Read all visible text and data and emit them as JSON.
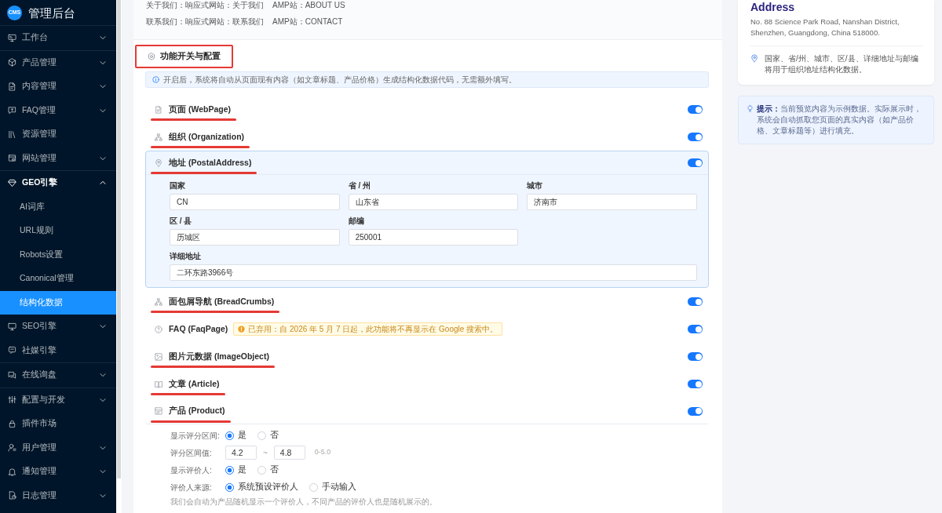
{
  "sidebar": {
    "logo_badge": "CMS",
    "title": "管理后台",
    "groups": [
      {
        "items": [
          {
            "label": "工作台",
            "kind": "menu",
            "expanded": false
          }
        ]
      },
      {
        "items": [
          {
            "label": "产品管理",
            "kind": "menu",
            "expanded": false
          },
          {
            "label": "内容管理",
            "kind": "menu",
            "expanded": false
          },
          {
            "label": "FAQ管理",
            "kind": "menu",
            "expanded": false
          },
          {
            "label": "资源管理",
            "kind": "link"
          },
          {
            "label": "网站管理",
            "kind": "menu",
            "expanded": false
          }
        ]
      },
      {
        "items": [
          {
            "label": "GEO引擎",
            "kind": "menu",
            "expanded": true,
            "children": [
              {
                "label": "AI词库",
                "selected": false
              },
              {
                "label": "URL规则",
                "selected": false
              },
              {
                "label": "Robots设置",
                "selected": false
              },
              {
                "label": "Canonical管理",
                "selected": false
              },
              {
                "label": "结构化数据",
                "selected": true
              }
            ]
          },
          {
            "label": "SEO引擎",
            "kind": "menu",
            "expanded": false
          },
          {
            "label": "社媒引擎",
            "kind": "link"
          }
        ]
      },
      {
        "items": [
          {
            "label": "在线询盘",
            "kind": "menu",
            "expanded": false
          }
        ]
      },
      {
        "items": [
          {
            "label": "配置与开发",
            "kind": "menu",
            "expanded": false
          },
          {
            "label": "插件市场",
            "kind": "link"
          },
          {
            "label": "用户管理",
            "kind": "menu",
            "expanded": false
          },
          {
            "label": "通知管理",
            "kind": "menu",
            "expanded": false
          },
          {
            "label": "日志管理",
            "kind": "menu",
            "expanded": false
          }
        ]
      }
    ]
  },
  "page_links": [
    {
      "site": "关于我们：响应式网站：关于我们",
      "amp": "AMP站：ABOUT US"
    },
    {
      "site": "联系我们：响应式网站：联系我们",
      "amp": "AMP站：CONTACT"
    }
  ],
  "features": {
    "title": "功能开关与配置",
    "outlined": true,
    "notice": "开启后，系统将自动从页面现有内容（如文章标题、产品价格）生成结构化数据代码，无需额外填写。",
    "types": [
      {
        "label": "页面 (WebPage)",
        "on": true,
        "underlined": true,
        "highlighted": false
      },
      {
        "label": "组织 (Organization)",
        "on": true,
        "underlined": true,
        "highlighted": false
      },
      {
        "label": "地址 (PostalAddress)",
        "on": true,
        "underlined": true,
        "highlighted": true,
        "fields": [
          {
            "label": "国家",
            "value": "CN",
            "kind": "short"
          },
          {
            "label": "省 / 州",
            "value": "山东省",
            "kind": "short"
          },
          {
            "label": "城市",
            "value": "济南市",
            "kind": "short"
          },
          {
            "label": "区 / 县",
            "value": "历城区",
            "kind": "short"
          },
          {
            "label": "邮编",
            "value": "250001",
            "kind": "short"
          },
          {
            "label": "详细地址",
            "value": "二环东路3966号",
            "kind": "long"
          }
        ]
      },
      {
        "label": "面包屑导航 (BreadCrumbs)",
        "on": true,
        "underlined": true,
        "highlighted": false
      },
      {
        "label": "FAQ (FaqPage)",
        "on": true,
        "underlined": false,
        "highlighted": false,
        "warning": "已弃用：自 2026 年 5 月 7 日起，此功能将不再显示在 Google 搜索中。"
      },
      {
        "label": "图片元数据 (ImageObject)",
        "on": true,
        "underlined": true,
        "highlighted": false
      },
      {
        "label": "文章 (Article)",
        "on": true,
        "underlined": true,
        "highlighted": false
      },
      {
        "label": "产品 (Product)",
        "on": true,
        "underlined": true,
        "highlighted": false,
        "options": [
          {
            "kind": "radio",
            "label": "显示评分区间:",
            "choices": [
              {
                "label": "是",
                "selected": true
              },
              {
                "label": "否",
                "selected": false
              }
            ]
          },
          {
            "kind": "range",
            "label": "评分区间值:",
            "from": "4.2",
            "separator": "~",
            "to": "4.8",
            "hint": "0-5.0"
          },
          {
            "kind": "radio",
            "label": "显示评价人:",
            "choices": [
              {
                "label": "是",
                "selected": true
              },
              {
                "label": "否",
                "selected": false
              }
            ]
          },
          {
            "kind": "radio",
            "label": "评价人来源:",
            "choices": [
              {
                "label": "系统预设评价人",
                "selected": true
              },
              {
                "label": "手动输入",
                "selected": false
              }
            ]
          }
        ],
        "note": "我们会自动为产品随机显示一个评价人，不同产品的评价人也是随机展示的。"
      }
    ]
  },
  "preview": {
    "heading": "Address",
    "address": "No. 88 Science Park Road, Nanshan District, Shenzhen, Guangdong, China 518000.",
    "note": "国家、省/州、城市、区/县、详细地址与邮编将用于组织地址结构化数据。"
  },
  "tip": "**提示：**当前预览内容为示例数据。实际展示时，系统会自动抓取您页面的真实内容（如产品价格、文章标题等）进行填充。"
}
